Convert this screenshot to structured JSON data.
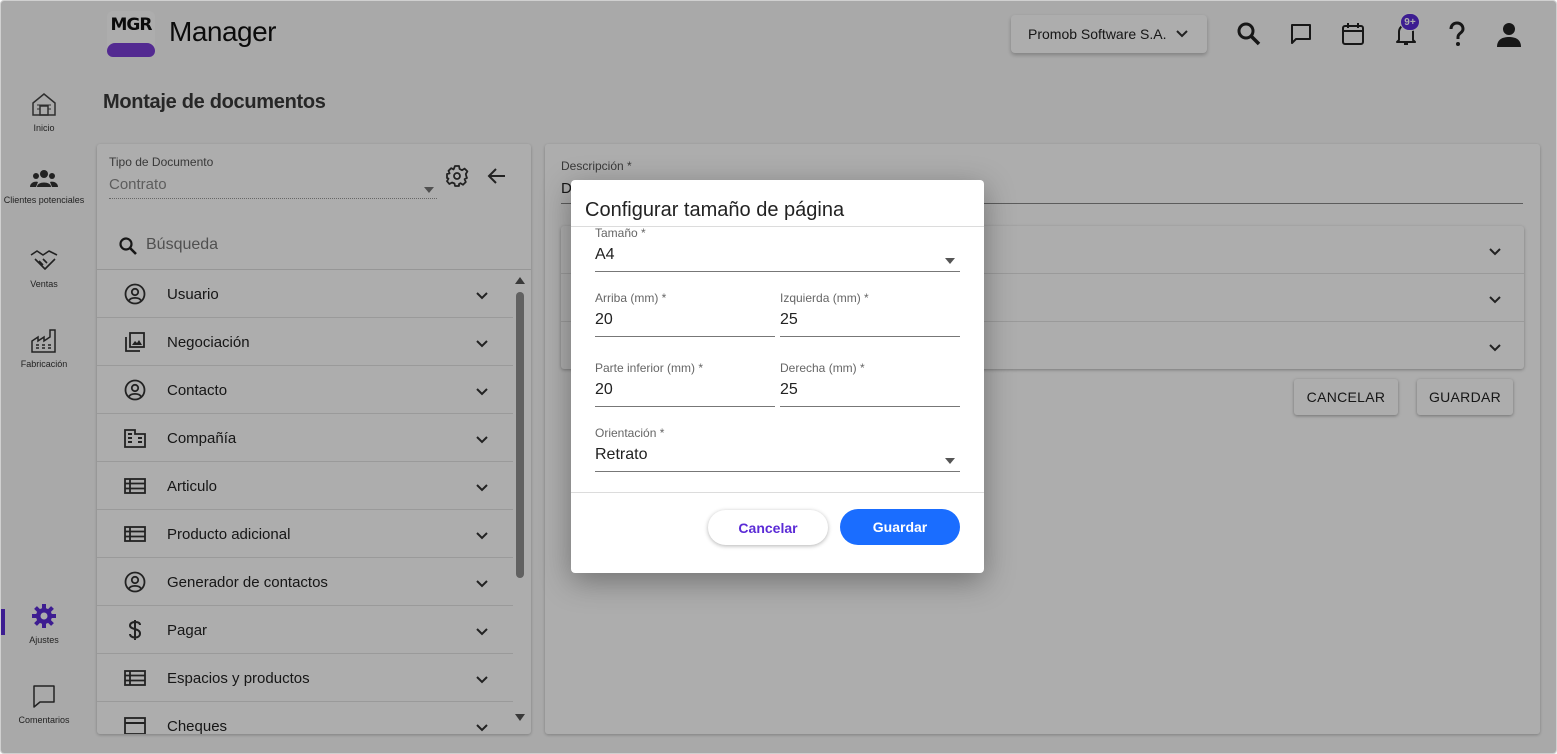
{
  "header": {
    "logo_text": "MGR",
    "app_name": "Manager",
    "company": "Promob Software S.A.",
    "notifications_badge": "9+",
    "icons": [
      "search-icon",
      "chat-icon",
      "calendar-icon",
      "bell-icon",
      "help-icon",
      "user-icon"
    ]
  },
  "sidebar": {
    "items": [
      {
        "label": "Inicio",
        "icon": "home-icon"
      },
      {
        "label": "Clientes potenciales",
        "icon": "people-icon"
      },
      {
        "label": "Ventas",
        "icon": "handshake-icon"
      },
      {
        "label": "Fabricación",
        "icon": "factory-icon"
      },
      {
        "label": "Ajustes",
        "icon": "gear-icon",
        "active": true
      },
      {
        "label": "Comentarios",
        "icon": "comment-icon"
      }
    ]
  },
  "page": {
    "title": "Montaje de documentos"
  },
  "left_panel": {
    "doc_type_label": "Tipo de Documento",
    "doc_type_value": "Contrato",
    "search_placeholder": "Búsqueda",
    "items": [
      {
        "label": "Usuario",
        "icon": "user-circle-icon"
      },
      {
        "label": "Negociación",
        "icon": "image-stack-icon"
      },
      {
        "label": "Contacto",
        "icon": "user-circle-icon"
      },
      {
        "label": "Compañía",
        "icon": "building-icon"
      },
      {
        "label": "Articulo",
        "icon": "list-icon"
      },
      {
        "label": "Producto adicional",
        "icon": "list-icon"
      },
      {
        "label": "Generador de contactos",
        "icon": "user-circle-icon"
      },
      {
        "label": "Pagar",
        "icon": "dollar-icon"
      },
      {
        "label": "Espacios y productos",
        "icon": "list-icon"
      },
      {
        "label": "Cheques",
        "icon": "check-icon"
      }
    ]
  },
  "right_panel": {
    "desc_label": "Descripción *",
    "desc_value": "D",
    "cancel_label": "CANCELAR",
    "save_label": "GUARDAR"
  },
  "dialog": {
    "title": "Configurar tamaño de página",
    "size_label": "Tamaño *",
    "size_value": "A4",
    "top_label": "Arriba (mm) *",
    "top_value": "20",
    "left_label": "Izquierda (mm) *",
    "left_value": "25",
    "bottom_label": "Parte inferior (mm) *",
    "bottom_value": "20",
    "right_label": "Derecha (mm) *",
    "right_value": "25",
    "orientation_label": "Orientación *",
    "orientation_value": "Retrato",
    "cancel_label": "Cancelar",
    "save_label": "Guardar"
  },
  "colors": {
    "accent": "#5b2bd6",
    "primary_button": "#1a6dff",
    "logo_purple": "#7b3fd6"
  }
}
